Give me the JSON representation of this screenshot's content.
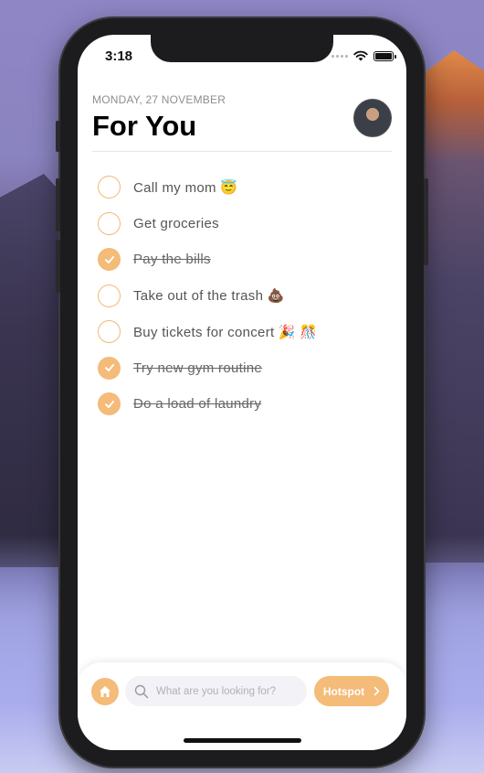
{
  "status_bar": {
    "time": "3:18"
  },
  "header": {
    "date": "MONDAY, 27 NOVEMBER",
    "title": "For You"
  },
  "tasks": [
    {
      "label": "Call my mom 😇",
      "done": false
    },
    {
      "label": "Get groceries",
      "done": false
    },
    {
      "label": "Pay the bills",
      "done": true
    },
    {
      "label": "Take out of the trash 💩",
      "done": false
    },
    {
      "label": "Buy tickets for concert 🎉 🎊",
      "done": false
    },
    {
      "label": "Try new gym routine",
      "done": true
    },
    {
      "label": "Do a load of laundry",
      "done": true
    }
  ],
  "bottom_bar": {
    "search_placeholder": "What are you looking for?",
    "hotspot_label": "Hotspot"
  },
  "colors": {
    "accent": "#f4bb79",
    "text": "#555555"
  },
  "icons": [
    "home-icon",
    "search-icon",
    "chevron-right-icon",
    "checkmark-icon",
    "wifi-icon",
    "battery-icon",
    "signal-icon"
  ]
}
